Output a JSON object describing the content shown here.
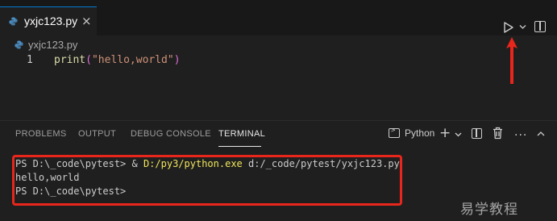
{
  "editor": {
    "tab": {
      "label": "yxjc123.py",
      "icon": "python-file-icon",
      "close": "×"
    },
    "breadcrumb": "yxjc123.py",
    "code": {
      "line_number": "1",
      "fn": "print",
      "open": "(",
      "string": "\"hello,world\"",
      "close": ")"
    },
    "actions": {
      "run_icon": "play-icon",
      "split_icon": "split-editor-icon"
    }
  },
  "panel": {
    "tabs": [
      "PROBLEMS",
      "OUTPUT",
      "DEBUG CONSOLE",
      "TERMINAL"
    ],
    "active_tab": "TERMINAL",
    "profile": "Python",
    "plus": "+",
    "more": "···"
  },
  "terminal": {
    "line1_prompt": "PS D:\\_code\\pytest> & ",
    "line1_exe": "D:/py3/python.exe",
    "line1_rest": " d:/_code/pytest/yxjc123.py",
    "line2": "hello,world",
    "line3": "PS D:\\_code\\pytest>"
  },
  "watermark": "易学教程",
  "colors": {
    "highlight_box": "#e8261c",
    "arrow": "#e8261c",
    "accent": "#0078d4"
  }
}
